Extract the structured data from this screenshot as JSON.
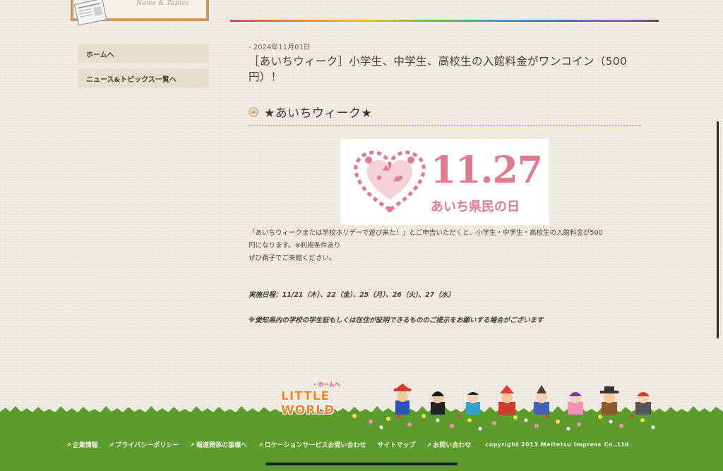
{
  "header": {
    "card_label": "News & Topics"
  },
  "sidebar": {
    "items": [
      {
        "label": "ホームへ"
      },
      {
        "label": "ニュース&トピックス一覧へ"
      }
    ]
  },
  "article": {
    "date": "- 2024年11月01日",
    "title": "［あいちウィーク］小学生、中学生、高校生の入館料金がワンコイン（500円）！",
    "section_title": "★あいちウィーク★",
    "banner": {
      "number": "11.27",
      "caption": "あいち県民の日"
    },
    "body_lines": [
      "「あいちウィークまたは学校ホリデーで遊び来た！」とご申告いただくと、小学生・中学生・高校生の入館料金が500",
      "円になります。※利用条件あり",
      "ぜひ親子でご来館ください。"
    ],
    "schedule": "実施日程：11/21（木）、22（金）、25（月）、26（火）、27（水）",
    "note": "※愛知県内の学校の学生証もしくは在住が証明できるもののご提示をお願いする場合がございます"
  },
  "footer": {
    "logo_top": "・ホームへ",
    "logo_text": "LITTLE WORLD",
    "links": [
      {
        "label": "企業情報",
        "external": true
      },
      {
        "label": "プライバシーポリシー",
        "external": true
      },
      {
        "label": "報道関係の皆様へ",
        "external": true
      },
      {
        "label": "ロケーションサービスお問い合わせ",
        "external": true
      },
      {
        "label": "サイトマップ",
        "external": false
      },
      {
        "label": "お問い合わせ",
        "external": true
      }
    ],
    "external_glyph": "⇗",
    "copyright": "copyright 2013 Meitetsu Impress Co.,Ltd"
  },
  "colors": {
    "accent": "#c69a63",
    "banner_pink": "#e07a8c",
    "grass": "#5c9c2f"
  }
}
